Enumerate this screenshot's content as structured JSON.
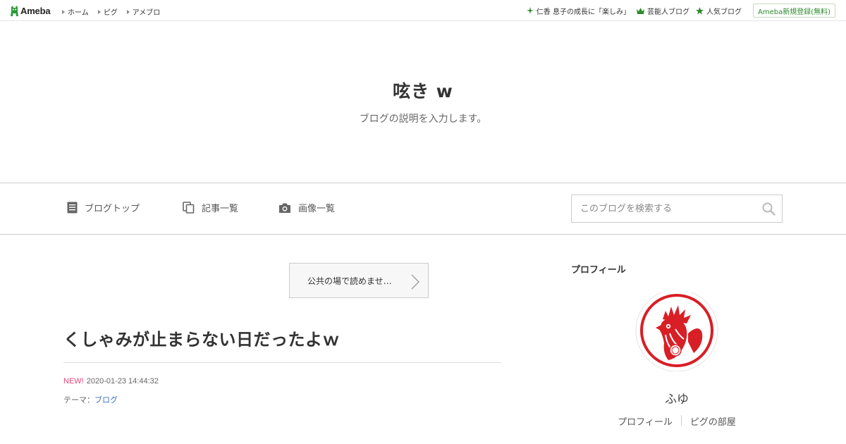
{
  "topbar": {
    "logo_text": "Ameba",
    "nav": [
      {
        "label": "ホーム"
      },
      {
        "label": "ピグ"
      },
      {
        "label": "アメブロ"
      }
    ],
    "right_links": [
      {
        "label": "仁香 息子の成長に「楽しみ」",
        "icon": "sparkle-icon"
      },
      {
        "label": "芸能人ブログ",
        "icon": "crown-icon"
      },
      {
        "label": "人気ブログ",
        "icon": "star-icon"
      }
    ],
    "register_label": "Ameba新規登録(無料)"
  },
  "header": {
    "title": "呟き w",
    "description": "ブログの説明を入力します。"
  },
  "nav": {
    "items": [
      {
        "label": "ブログトップ",
        "icon": "document-icon"
      },
      {
        "label": "記事一覧",
        "icon": "copy-icon"
      },
      {
        "label": "画像一覧",
        "icon": "camera-icon"
      }
    ],
    "search_placeholder": "このブログを検索する"
  },
  "main": {
    "theme_button_label": "公共の場で読めませ…",
    "entry": {
      "title": "くしゃみが止まらない日だったよｗ",
      "new_label": "NEW!",
      "timestamp": "2020-01-23 14:44:32",
      "theme_prefix": "テーマ：",
      "theme_link": "ブログ"
    }
  },
  "sidebar": {
    "heading": "プロフィール",
    "name": "ふゆ",
    "links": [
      {
        "label": "プロフィール"
      },
      {
        "label": "ピグの部屋"
      }
    ]
  },
  "colors": {
    "accent_green": "#2d8a2d",
    "new_pink": "#e0457b",
    "link_blue": "#3a74b8",
    "avatar_red": "#d81f26"
  }
}
